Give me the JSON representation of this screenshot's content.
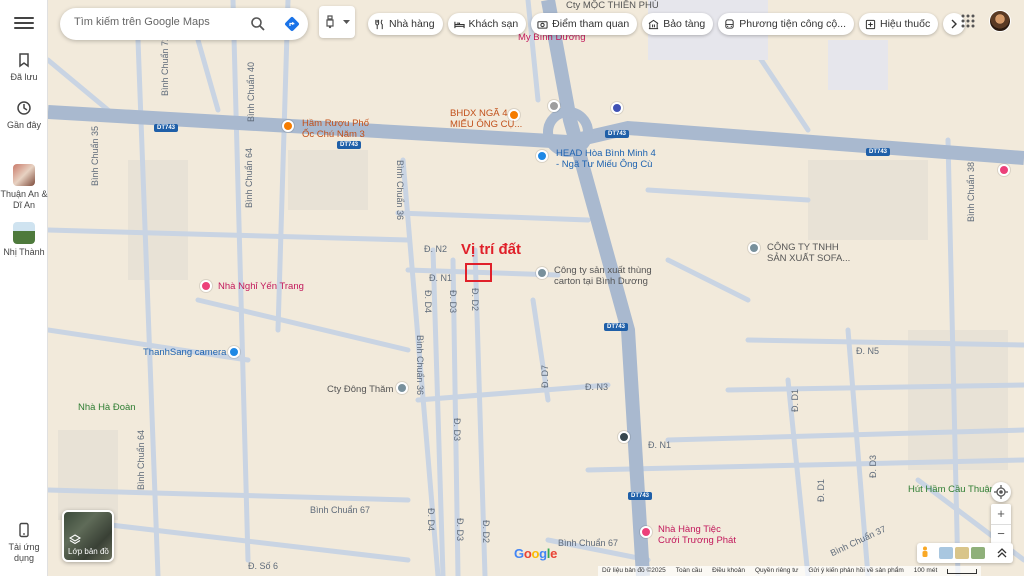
{
  "rail": {
    "saved_label": "Đã lưu",
    "recent_label": "Gần đây",
    "place1_label": "Thuận An & Dĩ An",
    "place2_label": "Nhị Thành",
    "app_label": "Tải ứng dụng"
  },
  "search": {
    "placeholder": "Tìm kiếm trên Google Maps"
  },
  "vehicle_icon": "motorbike-icon",
  "chips": [
    {
      "label": "Nhà hàng",
      "icon": "restaurant-icon"
    },
    {
      "label": "Khách sạn",
      "icon": "hotel-icon"
    },
    {
      "label": "Điểm tham quan",
      "icon": "camera-icon"
    },
    {
      "label": "Bảo tàng",
      "icon": "museum-icon"
    },
    {
      "label": "Phương tiện công cộ...",
      "icon": "transit-icon"
    },
    {
      "label": "Hiệu thuốc",
      "icon": "pharmacy-icon"
    }
  ],
  "annotation": "Vị trí đất",
  "streets": {
    "bc72": "Bình Chuẩn 72",
    "bc40": "Bình Chuẩn 40",
    "bc35": "Bình Chuẩn 35",
    "bc64a": "Bình Chuẩn 64",
    "bc64b": "Bình Chuẩn 64",
    "bc36a": "Bình Chuẩn 36",
    "bc36b": "Bình Chuẩn 36",
    "bc38": "Bình Chuẩn 38",
    "bc67a": "Bình Chuẩn 67",
    "bc67b": "Bình Chuẩn 67",
    "bc37": "Bình Chuẩn 37",
    "n1": "Đ. N1",
    "n2": "Đ. N2",
    "n3": "Đ. N3",
    "n5": "Đ. N5",
    "n1b": "Đ. N1",
    "d2": "Đ. D2",
    "d2b": "Đ. D2",
    "d3": "Đ. D3",
    "d3b": "Đ. D3",
    "d3c": "Đ. D3",
    "d4": "Đ. D4",
    "d4b": "Đ. D4",
    "d1": "Đ. D1",
    "d1b": "Đ. D1",
    "d3r": "Đ. D3",
    "d7": "Đ. D7",
    "s6": "Đ. Số 6"
  },
  "road_shield": "DT743",
  "pois": {
    "moc": "Cty MỘC THIÊN PHÚ",
    "mybd": "My Bình Dương",
    "ham": "Hầm Rượu Phố\nỐc Chú Năm 3",
    "bhdx": "BHDX NGÃ 4\nMIẾU ÔNG CỤ...",
    "head": "HEAD Hòa Bình Minh 4\n- Ngã Tư Miếu Ông Cù",
    "sofa": "CÔNG TY TNHH\nSẢN XUẤT SOFA...",
    "carton": "Công ty sản xuất thùng\ncarton tại Bình Dương",
    "yen": "Nhà Nghỉ Yến Trang",
    "thanh": "ThanhSang camera",
    "dong": "Cty Đông Thăm",
    "hadoan": "Nhà Hà Đoàn",
    "hut": "Hút Hầm Cầu Thuận",
    "tiec": "Nhà Hàng Tiệc\nCưới Trương Phát"
  },
  "layers_label": "Lớp bản đồ",
  "google": "Google",
  "footer": {
    "data": "Dữ liệu bản đồ ©2025",
    "global": "Toàn cầu",
    "terms": "Điều khoản",
    "privacy": "Quyền riêng tư",
    "feedback": "Gửi ý kiến phản hồi về sản phẩm",
    "scale": "100 mét"
  },
  "colors": {
    "land": "#f2eadb",
    "road": "#c9d4e3",
    "main_road": "#a9b9cf",
    "annotation": "#e0202a"
  }
}
